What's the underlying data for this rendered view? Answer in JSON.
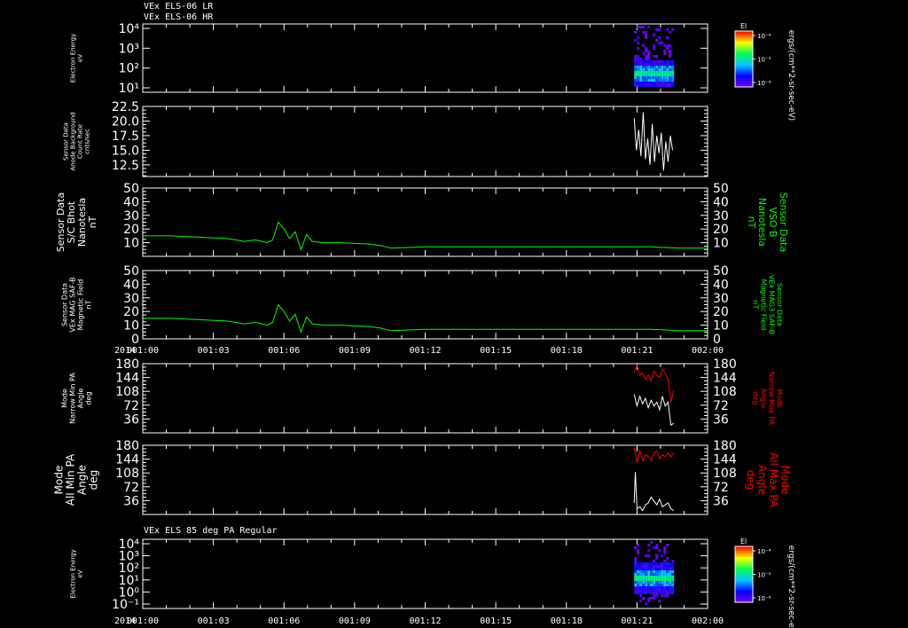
{
  "header": {
    "line1": "VEx ELS-06 LR",
    "line2": "VEx ELS-06 HR"
  },
  "xaxis": {
    "year": "2014",
    "ticks": [
      "001:00",
      "001:03",
      "001:06",
      "001:09",
      "001:12",
      "001:15",
      "001:18",
      "001:21",
      "002:00"
    ]
  },
  "colorbar": {
    "title": "El",
    "ticks": [
      "10⁻⁴",
      "10⁻⁵",
      "10⁻⁶"
    ],
    "units": "ergs/(cm**2-sr-sec-eV)"
  },
  "colors": {
    "green": "#00ff00",
    "red": "#ff0000",
    "white": "#ffffff"
  },
  "chart_data": [
    {
      "type": "heatmap",
      "ylabel": [
        "Electron Energy",
        "eV"
      ],
      "yticks": [
        "10⁴",
        "10³",
        "10²",
        "10¹"
      ],
      "scale": "log",
      "colorbar": true,
      "note_x_range": [
        0.87,
        0.94
      ]
    },
    {
      "type": "line",
      "ylabel": [
        "Sensor Data",
        "Anode Background",
        "Count Rate",
        "cnts/sec"
      ],
      "ylim": [
        10.5,
        22.5
      ],
      "yticks": [
        "22.5",
        "20.0",
        "17.5",
        "15.0",
        "12.5"
      ],
      "series": [
        {
          "color": "white",
          "x": [
            0.87,
            0.874,
            0.878,
            0.882,
            0.886,
            0.89,
            0.894,
            0.898,
            0.902,
            0.906,
            0.91,
            0.914,
            0.918,
            0.922,
            0.926,
            0.93,
            0.934,
            0.938
          ],
          "y": [
            20.5,
            15.0,
            18.5,
            14.0,
            21.5,
            13.5,
            17.0,
            12.5,
            19.5,
            13.0,
            17.5,
            14.5,
            18.0,
            11.5,
            16.5,
            13.0,
            17.5,
            15.0
          ]
        }
      ]
    },
    {
      "type": "line",
      "ylabel": [
        "Sensor Data",
        "S/C Bhot",
        "Nanotesla",
        "nT"
      ],
      "ylabel_right": [
        "Sensor Data",
        "VSO B",
        "Nanotesla",
        "nT"
      ],
      "ylim": [
        0,
        50
      ],
      "yticks": [
        "50",
        "40",
        "30",
        "20",
        "10"
      ],
      "series": [
        {
          "color": "green",
          "x": [
            0.0,
            0.05,
            0.1,
            0.15,
            0.18,
            0.2,
            0.22,
            0.23,
            0.24,
            0.25,
            0.26,
            0.27,
            0.28,
            0.29,
            0.3,
            0.32,
            0.35,
            0.4,
            0.42,
            0.44,
            0.5,
            0.6,
            0.7,
            0.8,
            0.9,
            0.95,
            1.0
          ],
          "y": [
            15,
            15,
            14,
            13,
            11,
            12,
            10,
            12,
            25,
            20,
            13,
            18,
            5,
            16,
            11,
            10,
            10,
            9,
            8,
            6,
            7,
            7,
            7,
            7,
            7,
            6,
            6
          ]
        }
      ]
    },
    {
      "type": "line",
      "ylabel": [
        "Sensor Data",
        "VEx MAG SAF-B",
        "Magnetic Field",
        "nT"
      ],
      "ylabel_right": [
        "Sensor Data",
        "VEx MAG3 SAF-B",
        "Magnetic Field",
        "nT"
      ],
      "ylim": [
        0,
        50
      ],
      "yticks": [
        "50",
        "40",
        "30",
        "20",
        "10",
        "0"
      ],
      "series": [
        {
          "color": "green",
          "x": [
            0.0,
            0.05,
            0.1,
            0.15,
            0.18,
            0.2,
            0.22,
            0.23,
            0.24,
            0.25,
            0.26,
            0.27,
            0.28,
            0.29,
            0.3,
            0.32,
            0.35,
            0.4,
            0.42,
            0.44,
            0.5,
            0.6,
            0.7,
            0.8,
            0.9,
            0.95,
            1.0
          ],
          "y": [
            15,
            15,
            14,
            13,
            11,
            12,
            10,
            12,
            25,
            20,
            13,
            18,
            5,
            16,
            11,
            10,
            10,
            9,
            8,
            6,
            7,
            7,
            7,
            7,
            7,
            6,
            6
          ]
        }
      ]
    },
    {
      "type": "line",
      "ylabel": [
        "Mode",
        "Narrow Min PA",
        "Angle",
        "deg"
      ],
      "ylabel_right": [
        "Mode",
        "Narrow Max PA",
        "Angle",
        "deg"
      ],
      "ylim": [
        0,
        180
      ],
      "yticks": [
        "180",
        "144",
        "108",
        "72",
        "36"
      ],
      "series": [
        {
          "color": "white",
          "x": [
            0.87,
            0.875,
            0.88,
            0.885,
            0.89,
            0.895,
            0.9,
            0.905,
            0.91,
            0.915,
            0.92,
            0.925,
            0.93,
            0.935,
            0.94
          ],
          "y": [
            100,
            70,
            95,
            75,
            90,
            65,
            85,
            70,
            80,
            60,
            95,
            70,
            80,
            20,
            25
          ]
        },
        {
          "color": "red",
          "x": [
            0.87,
            0.875,
            0.88,
            0.885,
            0.89,
            0.895,
            0.9,
            0.905,
            0.91,
            0.915,
            0.92,
            0.925,
            0.93,
            0.935,
            0.94
          ],
          "y": [
            160,
            175,
            150,
            155,
            140,
            150,
            135,
            160,
            150,
            145,
            165,
            155,
            140,
            80,
            110
          ]
        }
      ]
    },
    {
      "type": "line",
      "ylabel": [
        "Mode",
        "All Min PA",
        "Angle",
        "deg"
      ],
      "ylabel_right": [
        "Mode",
        "All Max PA",
        "Angle",
        "deg"
      ],
      "ylim": [
        0,
        180
      ],
      "yticks": [
        "180",
        "144",
        "108",
        "72",
        "36"
      ],
      "series": [
        {
          "color": "white",
          "x": [
            0.87,
            0.872,
            0.875,
            0.88,
            0.885,
            0.89,
            0.895,
            0.9,
            0.905,
            0.91,
            0.915,
            0.92,
            0.925,
            0.93,
            0.935,
            0.94
          ],
          "y": [
            30,
            110,
            15,
            20,
            10,
            25,
            30,
            45,
            35,
            25,
            40,
            20,
            25,
            30,
            15,
            10
          ]
        },
        {
          "color": "red",
          "x": [
            0.87,
            0.875,
            0.88,
            0.885,
            0.89,
            0.895,
            0.9,
            0.905,
            0.91,
            0.915,
            0.92,
            0.925,
            0.93,
            0.935,
            0.94
          ],
          "y": [
            175,
            135,
            165,
            140,
            155,
            150,
            140,
            160,
            165,
            145,
            155,
            150,
            160,
            150,
            160
          ]
        }
      ]
    },
    {
      "type": "heatmap",
      "title": "VEx ELS 85 deg PA Regular",
      "ylabel": [
        "Electron Energy",
        "eV"
      ],
      "yticks": [
        "10⁴",
        "10³",
        "10²",
        "10¹",
        "10⁰",
        "10⁻¹"
      ],
      "scale": "log",
      "colorbar": true,
      "note_x_range": [
        0.87,
        0.94
      ]
    }
  ]
}
